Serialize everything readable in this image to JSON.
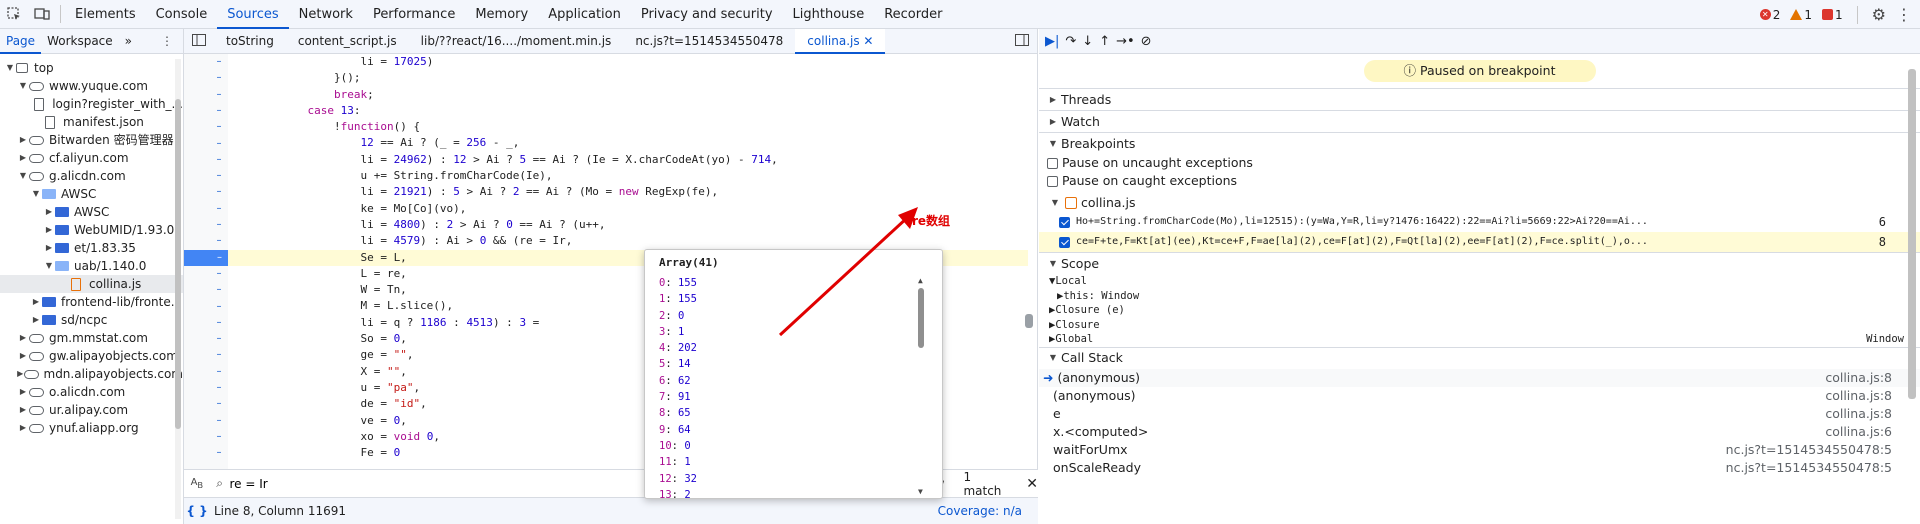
{
  "toolbar": {
    "tabs": [
      "Elements",
      "Console",
      "Sources",
      "Network",
      "Performance",
      "Memory",
      "Application",
      "Privacy and security",
      "Lighthouse",
      "Recorder"
    ],
    "active_tab": "Sources",
    "errors": "2",
    "warnings": "1",
    "issues": "1"
  },
  "navigator": {
    "tabs": [
      "Page",
      "Workspace"
    ],
    "more": "»",
    "tree": [
      {
        "label": "top",
        "type": "top",
        "depth": 0,
        "arrow": "▼"
      },
      {
        "label": "www.yuque.com",
        "type": "cloud",
        "depth": 1,
        "arrow": "▼"
      },
      {
        "label": "login?register_with_...",
        "type": "file",
        "depth": 2,
        "arrow": ""
      },
      {
        "label": "manifest.json",
        "type": "file",
        "depth": 2,
        "arrow": ""
      },
      {
        "label": "Bitwarden 密码管理器",
        "type": "cloud",
        "depth": 1,
        "arrow": "▶"
      },
      {
        "label": "cf.aliyun.com",
        "type": "cloud",
        "depth": 1,
        "arrow": "▶"
      },
      {
        "label": "g.alicdn.com",
        "type": "cloud",
        "depth": 1,
        "arrow": "▼"
      },
      {
        "label": "AWSC",
        "type": "folder-open",
        "depth": 2,
        "arrow": "▼"
      },
      {
        "label": "AWSC",
        "type": "folder",
        "depth": 3,
        "arrow": "▶"
      },
      {
        "label": "WebUMID/1.93.0",
        "type": "folder",
        "depth": 3,
        "arrow": "▶"
      },
      {
        "label": "et/1.83.35",
        "type": "folder",
        "depth": 3,
        "arrow": "▶"
      },
      {
        "label": "uab/1.140.0",
        "type": "folder-open",
        "depth": 3,
        "arrow": "▼"
      },
      {
        "label": "collina.js",
        "type": "file-js",
        "depth": 4,
        "arrow": "",
        "selected": true
      },
      {
        "label": "frontend-lib/fronte...",
        "type": "folder",
        "depth": 2,
        "arrow": "▶"
      },
      {
        "label": "sd/ncpc",
        "type": "folder",
        "depth": 2,
        "arrow": "▶"
      },
      {
        "label": "gm.mmstat.com",
        "type": "cloud",
        "depth": 1,
        "arrow": "▶"
      },
      {
        "label": "gw.alipayobjects.com",
        "type": "cloud",
        "depth": 1,
        "arrow": "▶"
      },
      {
        "label": "mdn.alipayobjects.com",
        "type": "cloud",
        "depth": 1,
        "arrow": "▶"
      },
      {
        "label": "o.alicdn.com",
        "type": "cloud",
        "depth": 1,
        "arrow": "▶"
      },
      {
        "label": "ur.alipay.com",
        "type": "cloud",
        "depth": 1,
        "arrow": "▶"
      },
      {
        "label": "ynuf.aliapp.org",
        "type": "cloud",
        "depth": 1,
        "arrow": "▶"
      }
    ]
  },
  "editor": {
    "tabs": [
      "toString",
      "content_script.js",
      "lib/??react/16..../moment.min.js",
      "nc.js?t=1514534550478",
      "collina.js"
    ],
    "active_tab": "collina.js",
    "lines": [
      {
        "text": "                    li = 17025)",
        "marker": "–"
      },
      {
        "text": "                }();",
        "marker": "–"
      },
      {
        "text": "                break;",
        "marker": "–"
      },
      {
        "text": "            case 13:",
        "marker": "–"
      },
      {
        "text": "                !function() {",
        "marker": "–"
      },
      {
        "text": "                    12 == Ai ? (_ = 256 - _,",
        "marker": "–"
      },
      {
        "text": "                    li = 24962) : 12 > Ai ? 5 == Ai ? (Ie = X.charCodeAt(yo) - 714,",
        "marker": "–"
      },
      {
        "text": "                    u += String.fromCharCode(Ie),",
        "marker": "–"
      },
      {
        "text": "                    li = 21921) : 5 > Ai ? 2 == Ai ? (Mo = new RegExp(fe),",
        "marker": "–"
      },
      {
        "text": "                    ke = Mo[Co](vo),",
        "marker": "–"
      },
      {
        "text": "                    li = 4800) : 2 > Ai ? 0 == Ai ? (u++,",
        "marker": "–"
      },
      {
        "text": "                    li = 4579) : Ai > 0 && (re = Ir,",
        "marker": "–"
      },
      {
        "text": "                    Se = L,",
        "marker": "–",
        "highlight": true
      },
      {
        "text": "                    L = re,",
        "marker": "–"
      },
      {
        "text": "                    W = Tn,",
        "marker": "–"
      },
      {
        "text": "                    M = L.slice(),",
        "marker": "–"
      },
      {
        "text": "                    li = q ? 1186 : 4513) : 3 =",
        "marker": "–"
      },
      {
        "text": "                    So = 0,",
        "marker": "–"
      },
      {
        "text": "                    ge = \"\",",
        "marker": "–"
      },
      {
        "text": "                    X = \"\",",
        "marker": "–"
      },
      {
        "text": "                    u = \"pa\",",
        "marker": "–"
      },
      {
        "text": "                    de = \"id\",",
        "marker": "–"
      },
      {
        "text": "                    ve = 0,",
        "marker": "–"
      },
      {
        "text": "                    xo = void 0,",
        "marker": "–"
      },
      {
        "text": "                    Fe = 0",
        "marker": "–"
      }
    ],
    "search": {
      "value": "re = Ir",
      "match_case": "Aa",
      "regex": "(.*)",
      "matches": "1 match"
    },
    "status": {
      "position": "Line 8, Column 11691",
      "coverage": "Coverage: n/a"
    }
  },
  "popover": {
    "title": "Array(41)",
    "items": [
      {
        "key": "0",
        "value": "155"
      },
      {
        "key": "1",
        "value": "155"
      },
      {
        "key": "2",
        "value": "0"
      },
      {
        "key": "3",
        "value": "1"
      },
      {
        "key": "4",
        "value": "202"
      },
      {
        "key": "5",
        "value": "14"
      },
      {
        "key": "6",
        "value": "62"
      },
      {
        "key": "7",
        "value": "91"
      },
      {
        "key": "8",
        "value": "65"
      },
      {
        "key": "9",
        "value": "64"
      },
      {
        "key": "10",
        "value": "0"
      },
      {
        "key": "11",
        "value": "1"
      },
      {
        "key": "12",
        "value": "32"
      },
      {
        "key": "13",
        "value": "2"
      }
    ]
  },
  "annotation": {
    "label": "re数组",
    "color": "#e00000"
  },
  "debugger": {
    "paused": "Paused on breakpoint",
    "sections": {
      "threads": "Threads",
      "watch": "Watch",
      "breakpoints": "Breakpoints",
      "scope": "Scope",
      "callstack": "Call Stack"
    },
    "pause_uncaught": "Pause on uncaught exceptions",
    "pause_caught": "Pause on caught exceptions",
    "bp_file": "collina.js",
    "breakpoints": [
      {
        "code": "Ho+=String.fromCharCode(Mo),li=12515):(y=Wa,Y=R,li=y?1476:16422):22==Ai?li=5669:22>Ai?20==Ai...",
        "line": "6",
        "active": false
      },
      {
        "code": "ce=F+te,F=Kt[at](ee),Kt=ce+F,F=ae[la](2),ce=F[at](2),F=Qt[la](2),ee=F[at](2),F=ce.split(_),o...",
        "line": "8",
        "active": true
      }
    ],
    "scope": [
      {
        "label": "Local",
        "arrow": "▼",
        "indent": 0,
        "value": ""
      },
      {
        "label": "this: Window",
        "arrow": "▶",
        "indent": 1,
        "value": ""
      },
      {
        "label": "Closure (e)",
        "arrow": "▶",
        "indent": 0,
        "value": ""
      },
      {
        "label": "Closure",
        "arrow": "▶",
        "indent": 0,
        "value": ""
      },
      {
        "label": "Global",
        "arrow": "▶",
        "indent": 0,
        "value": "Window"
      }
    ],
    "callstack": [
      {
        "fn": "(anonymous)",
        "loc": "collina.js:8",
        "current": true
      },
      {
        "fn": "(anonymous)",
        "loc": "collina.js:8",
        "current": false
      },
      {
        "fn": "e",
        "loc": "collina.js:8",
        "current": false
      },
      {
        "fn": "x.<computed>",
        "loc": "collina.js:6",
        "current": false
      },
      {
        "fn": "waitForUmx",
        "loc": "nc.js?t=1514534550478:5",
        "current": false
      },
      {
        "fn": "onScaleReady",
        "loc": "nc.js?t=1514534550478:5",
        "current": false
      }
    ]
  }
}
